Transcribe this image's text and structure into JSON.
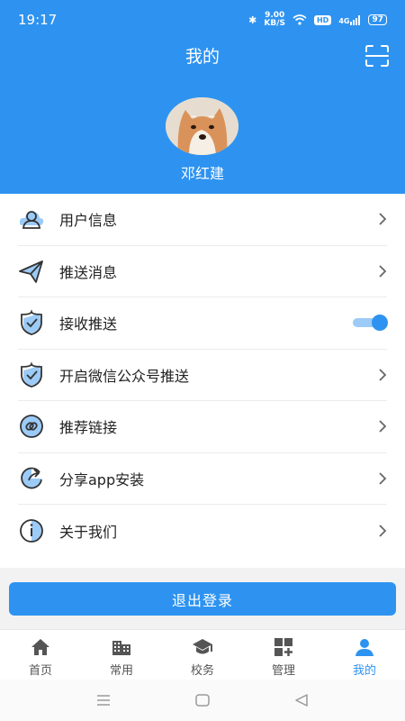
{
  "status": {
    "time": "19:17",
    "net_speed": "9.00",
    "net_unit": "KB/S",
    "hd": "HD",
    "signal": "4G",
    "battery": "97"
  },
  "header": {
    "title": "我的",
    "scan_icon": "scan-icon"
  },
  "user": {
    "name": "邓红建",
    "avatar": "shiba-avatar"
  },
  "menu": [
    {
      "label": "用户信息",
      "icon": "user-cloud-icon",
      "control": "arrow"
    },
    {
      "label": "推送消息",
      "icon": "paper-plane-icon",
      "control": "arrow"
    },
    {
      "label": "接收推送",
      "icon": "shield-check-icon",
      "control": "toggle",
      "toggle_on": true
    },
    {
      "label": "开启微信公众号推送",
      "icon": "shield-check-icon",
      "control": "arrow"
    },
    {
      "label": "推荐链接",
      "icon": "link-icon",
      "control": "arrow"
    },
    {
      "label": "分享app安装",
      "icon": "share-icon",
      "control": "arrow"
    },
    {
      "label": "关于我们",
      "icon": "info-icon",
      "control": "arrow"
    }
  ],
  "logout_label": "退出登录",
  "tabs": [
    {
      "label": "首页",
      "icon": "home-icon"
    },
    {
      "label": "常用",
      "icon": "building-icon"
    },
    {
      "label": "校务",
      "icon": "graduation-cap-icon"
    },
    {
      "label": "管理",
      "icon": "grid-plus-icon"
    },
    {
      "label": "我的",
      "icon": "person-icon",
      "active": true
    }
  ],
  "colors": {
    "primary": "#2e93f0",
    "toggle_track": "#9ccbf7",
    "background": "#f2f2f2"
  }
}
